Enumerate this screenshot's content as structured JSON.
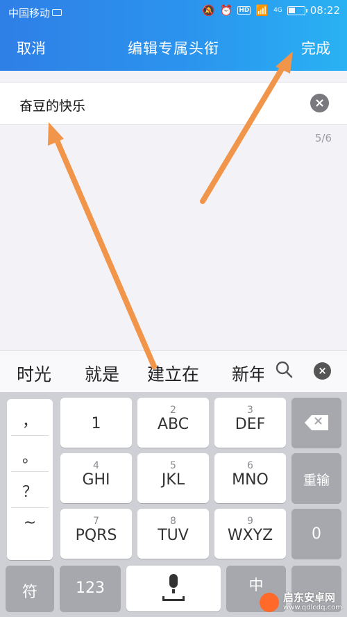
{
  "status_bar": {
    "carrier": "中国移动",
    "time": "08:22",
    "hd_badge": "HD",
    "network": "4G"
  },
  "title_bar": {
    "cancel_label": "取消",
    "title": "编辑专属头衔",
    "done_label": "完成"
  },
  "editor": {
    "value": "奋豆的快乐",
    "clear_icon": "×",
    "counter": "5/6"
  },
  "candidates": {
    "items": [
      "时光",
      "就是",
      "建立在",
      "新年"
    ],
    "search_icon": "search-icon",
    "close_icon": "×"
  },
  "keyboard": {
    "punctuation": [
      "，",
      "。",
      "？",
      "~"
    ],
    "keys": {
      "k1": {
        "num": "",
        "label": "1"
      },
      "k2": {
        "num": "2",
        "label": "ABC"
      },
      "k3": {
        "num": "3",
        "label": "DEF"
      },
      "k4": {
        "num": "4",
        "label": "GHI"
      },
      "k5": {
        "num": "5",
        "label": "JKL"
      },
      "k6": {
        "num": "6",
        "label": "MNO"
      },
      "k7": {
        "num": "7",
        "label": "PQRS"
      },
      "k8": {
        "num": "8",
        "label": "TUV"
      },
      "k9": {
        "num": "9",
        "label": "WXYZ"
      }
    },
    "reenter_label": "重输",
    "zero_label": "0",
    "symbol_label": "符",
    "num_label": "123",
    "lang_label": "中"
  },
  "watermark": {
    "text": "启东安卓网",
    "url": "www.qdlcdq.com"
  },
  "colors": {
    "header_start": "#2f7fe6",
    "header_end": "#29b2f3",
    "arrow": "#f0954a"
  }
}
